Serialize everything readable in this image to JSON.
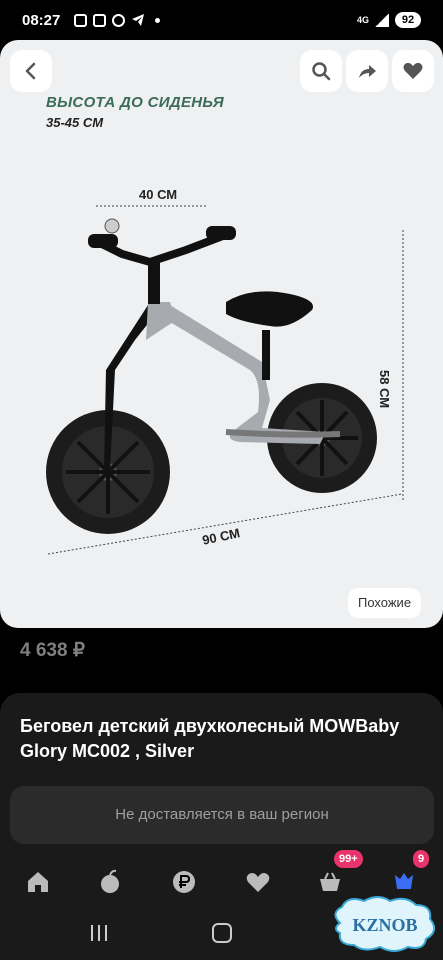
{
  "status_bar": {
    "time": "08:27",
    "network": "4G",
    "battery": "92"
  },
  "header": {
    "back_icon": "chevron-left-icon",
    "search_icon": "search-icon",
    "share_icon": "share-icon",
    "favorite_icon": "heart-icon"
  },
  "image": {
    "seat_height_label": "ВЫСОТА ДО СИДЕНЬЯ",
    "seat_height_value": "35-45 СМ",
    "dim_handlebar": "40 СМ",
    "dim_height": "58 СМ",
    "dim_length": "90 СМ",
    "similar_button": "Похожие"
  },
  "product": {
    "price": "4 638 ₽",
    "title": "Беговел детский двухколесный MOWBaby Glory MC002 , Silver"
  },
  "delivery": {
    "message": "Не доставляется в ваш регион"
  },
  "nav": {
    "items": [
      {
        "icon": "home-icon"
      },
      {
        "icon": "catalog-icon"
      },
      {
        "icon": "payment-icon"
      },
      {
        "icon": "heart-icon"
      },
      {
        "icon": "cart-icon",
        "badge": "99+"
      },
      {
        "icon": "profile-icon",
        "badge": "9"
      }
    ]
  },
  "watermark": {
    "text": "KZNOB"
  },
  "colors": {
    "accent": "#e8336d",
    "title_green": "#3c6b5a",
    "background": "#000000",
    "card": "#1a1a1a",
    "hero_background": "#eef0f2"
  }
}
